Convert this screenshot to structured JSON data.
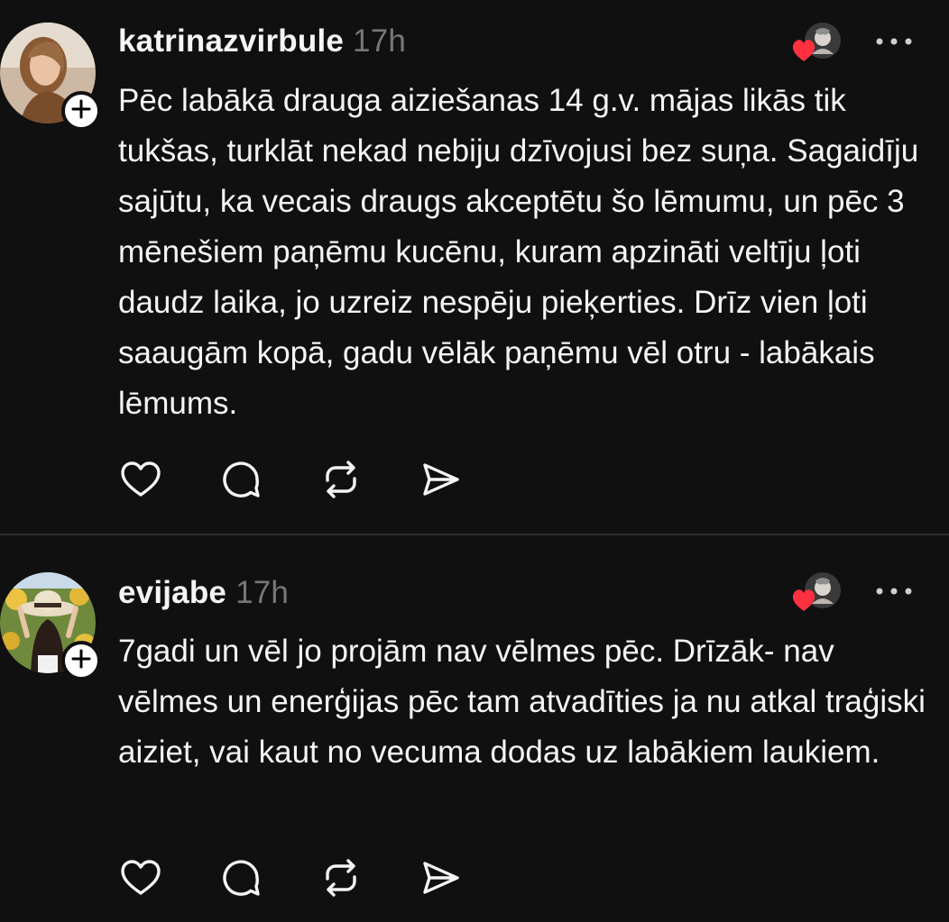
{
  "posts": [
    {
      "username": "katrinazvirbule",
      "time": "17h",
      "text": "Pēc labākā drauga aiziešanas 14 g.v. mājas likās tik tukšas, turklāt nekad nebiju dzīvojusi bez suņa. Sagaidīju sajūtu, ka vecais draugs akceptētu šo lēmumu, un pēc 3 mēnešiem paņēmu kucēnu, kuram apzināti veltīju ļoti daudz laika, jo uzreiz nespēju pieķerties. Drīz vien ļoti saaugām kopā, gadu vēlāk paņēmu vēl otru - labākais lēmums.",
      "icons": {
        "avatar": "avatar-photo-woman",
        "follow": "plus-icon",
        "liked_by": "liked-by-avatar-heart",
        "more": "more-icon",
        "actions": [
          "heart-icon",
          "comment-icon",
          "repost-icon",
          "share-icon"
        ]
      }
    },
    {
      "username": "evijabe",
      "time": "17h",
      "text": "7gadi un vēl jo projām nav vēlmes pēc. Drīzāk- nav vēlmes un enerģijas pēc tam atvadīties ja nu atkal traģiski aiziet, vai kaut no vecuma dodas uz labākiem laukiem.",
      "icons": {
        "avatar": "avatar-photo-woman-hat",
        "follow": "plus-icon",
        "liked_by": "liked-by-avatar-heart",
        "more": "more-icon",
        "actions": [
          "heart-icon",
          "comment-icon",
          "repost-icon",
          "share-icon"
        ]
      }
    }
  ],
  "colors": {
    "background": "#101010",
    "text": "#f3f5f7",
    "muted": "#777777",
    "divider": "#2e2e2e",
    "like_heart": "#ff3040"
  }
}
